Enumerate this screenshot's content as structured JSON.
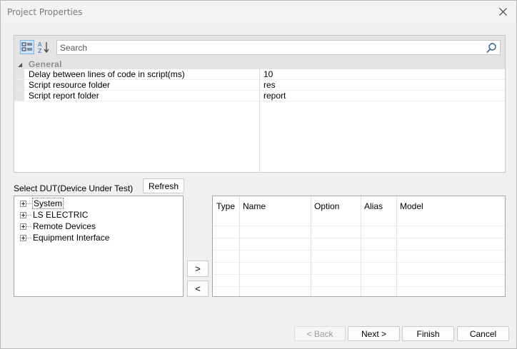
{
  "window": {
    "title": "Project Properties"
  },
  "toolbar": {
    "categorized_icon": "categorized-icon",
    "alphabetical_icon": "sort-az-icon"
  },
  "search": {
    "placeholder": "Search",
    "value": ""
  },
  "category": {
    "label": "General"
  },
  "properties": [
    {
      "name": "Delay between lines of code in script(ms)",
      "value": "10"
    },
    {
      "name": "Script resource folder",
      "value": "res"
    },
    {
      "name": "Script report folder",
      "value": "report"
    }
  ],
  "dut": {
    "label": "Select DUT(Device Under Test)",
    "refresh_label": "Refresh",
    "tree": [
      "System",
      "LS ELECTRIC",
      "Remote Devices",
      "Equipment Interface"
    ]
  },
  "transfer": {
    "add_label": ">",
    "remove_label": "<"
  },
  "grid": {
    "columns": [
      "Type",
      "Name",
      "Option",
      "Alias",
      "Model"
    ]
  },
  "footer": {
    "back_label": "< Back",
    "next_label": "Next >",
    "finish_label": "Finish",
    "cancel_label": "Cancel"
  }
}
